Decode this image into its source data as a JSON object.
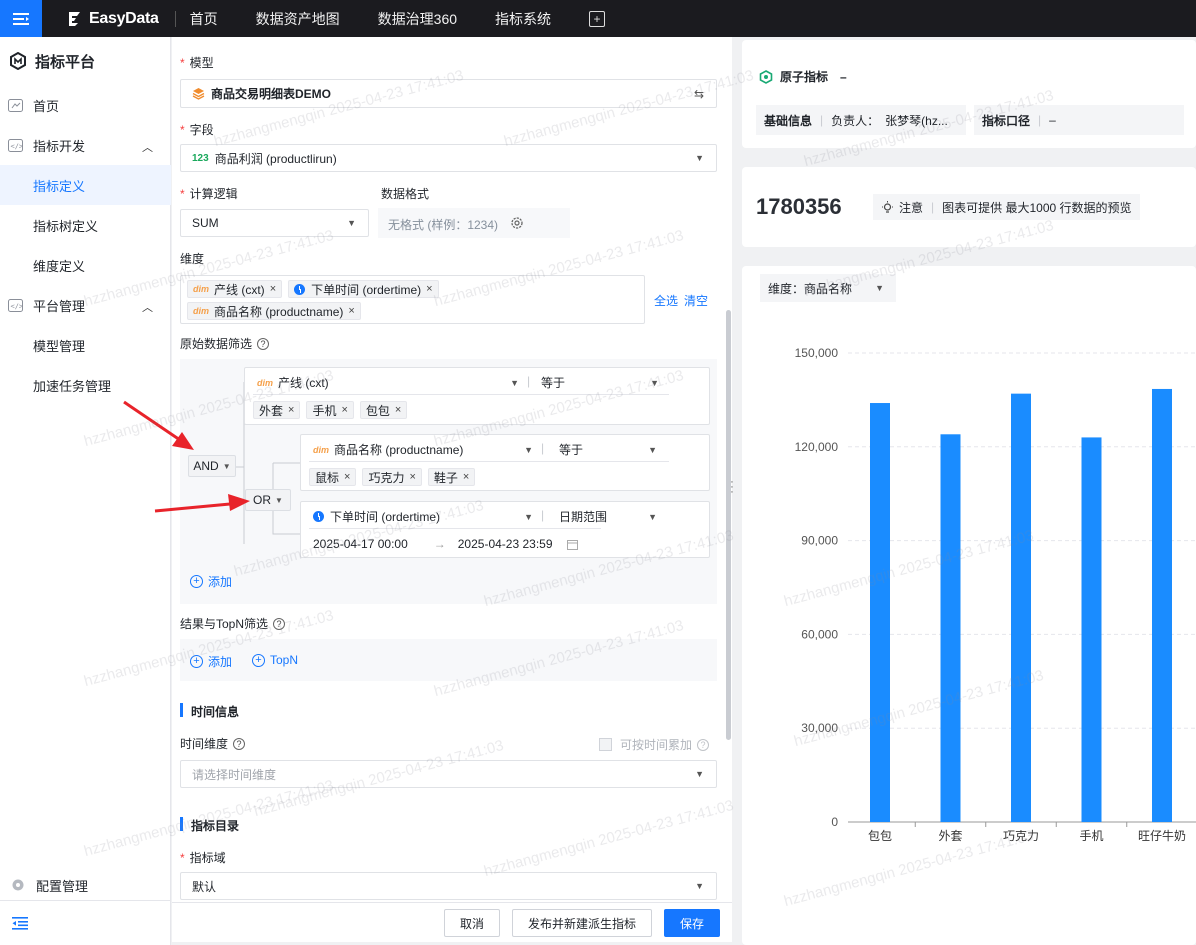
{
  "topbar": {
    "brand": "EasyData",
    "nav": [
      "首页",
      "数据资产地图",
      "数据治理360",
      "指标系统"
    ]
  },
  "sidebar": {
    "title": "指标平台",
    "items": [
      {
        "label": "首页"
      },
      {
        "label": "指标开发"
      },
      {
        "label": "指标定义"
      },
      {
        "label": "指标树定义"
      },
      {
        "label": "维度定义"
      },
      {
        "label": "平台管理"
      },
      {
        "label": "模型管理"
      },
      {
        "label": "加速任务管理"
      }
    ],
    "bottom": "配置管理"
  },
  "form": {
    "model_label": "模型",
    "model_value": "商品交易明细表DEMO",
    "field_label": "字段",
    "field_badge": "123",
    "field_value": "商品利润 (productlirun)",
    "calc_label": "计算逻辑",
    "calc_value": "SUM",
    "format_label": "数据格式",
    "format_value": "无格式 (样例：1234)",
    "dims_label": "维度",
    "dim_prefix": "dim",
    "dims": [
      "产线 (cxt)",
      "下单时间 (ordertime)",
      "商品名称 (productname)"
    ],
    "select_all": "全选",
    "clear": "清空",
    "filter_label": "原始数据筛选",
    "and_label": "AND",
    "or_label": "OR",
    "cond1": {
      "field": "产线 (cxt)",
      "op": "等于",
      "values": [
        "外套",
        "手机",
        "包包"
      ]
    },
    "cond2": {
      "field": "商品名称 (productname)",
      "op": "等于",
      "values": [
        "鼠标",
        "巧克力",
        "鞋子"
      ]
    },
    "cond3": {
      "field": "下单时间 (ordertime)",
      "op": "日期范围",
      "start": "2025-04-17 00:00",
      "end": "2025-04-23 23:59"
    },
    "add": "添加",
    "topn_label": "结果与TopN筛选",
    "topn": "TopN",
    "time_section": "时间信息",
    "time_dim_label": "时间维度",
    "time_accum": "可按时间累加",
    "time_dim_placeholder": "请选择时间维度",
    "catalog_section": "指标目录",
    "domain_label": "指标域",
    "domain_value": "默认"
  },
  "footer": {
    "cancel": "取消",
    "publish": "发布并新建派生指标",
    "save": "保存"
  },
  "right": {
    "atomic_label": "原子指标",
    "atomic_value": "–",
    "basic_info": "基础信息",
    "owner": "负责人：",
    "owner_name": "张梦琴(hz...",
    "caliber": "指标口径",
    "caliber_value": "–",
    "total": "1780356",
    "note": "注意",
    "note_text": "图表可提供 最大1000 行数据的预览",
    "dim_select": "维度：商品名称"
  },
  "watermark": "hzzhangmengqin 2025-04-23 17:41:03",
  "chart_data": {
    "type": "bar",
    "categories": [
      "包包",
      "外套",
      "巧克力",
      "手机",
      "旺仔牛奶"
    ],
    "values": [
      134000,
      124000,
      137000,
      123000,
      138500
    ],
    "ylim": [
      0,
      150000
    ],
    "yticks": [
      0,
      30000,
      60000,
      90000,
      120000,
      150000
    ],
    "ytick_labels": [
      "0",
      "30,000",
      "60,000",
      "90,000",
      "120,000",
      "150,000"
    ],
    "color": "#1a8cff",
    "grid": true
  }
}
